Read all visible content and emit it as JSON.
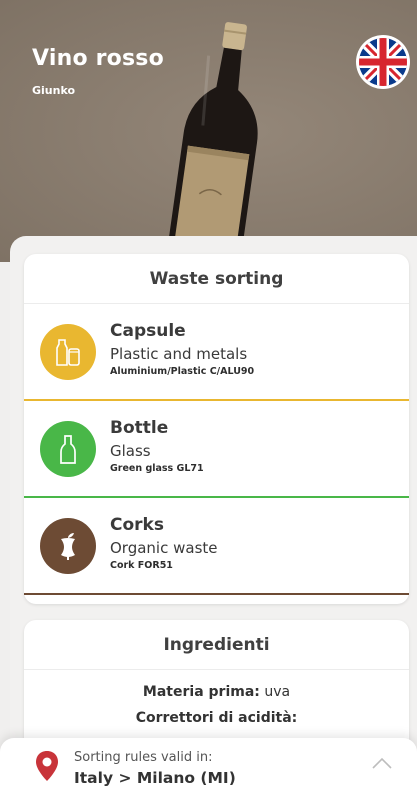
{
  "product": {
    "name": "Vino rosso",
    "brand": "Giunko",
    "language_flag_icon": "uk-flag-icon"
  },
  "waste_sorting": {
    "title": "Waste sorting",
    "items": [
      {
        "name": "Capsule",
        "material": "Plastic and metals",
        "code": "Aluminium/Plastic C/ALU90",
        "color": "#e9b730",
        "icon": "plastic-bottle-can-icon"
      },
      {
        "name": "Bottle",
        "material": "Glass",
        "code": "Green glass GL71",
        "color": "#49b748",
        "icon": "glass-bottle-icon"
      },
      {
        "name": "Corks",
        "material": "Organic waste",
        "code": "Cork FOR51",
        "color": "#6d4b34",
        "icon": "apple-core-icon"
      }
    ]
  },
  "ingredients": {
    "title": "Ingredienti",
    "line1_label": "Materia prima:",
    "line1_value": " uva",
    "line2": "Correttori di acidità:"
  },
  "footer": {
    "label": "Sorting rules valid in:",
    "value": "Italy > Milano (MI)",
    "pin_icon": "location-pin-icon",
    "pin_color": "#c8343a",
    "expand_icon": "chevron-up-icon"
  }
}
